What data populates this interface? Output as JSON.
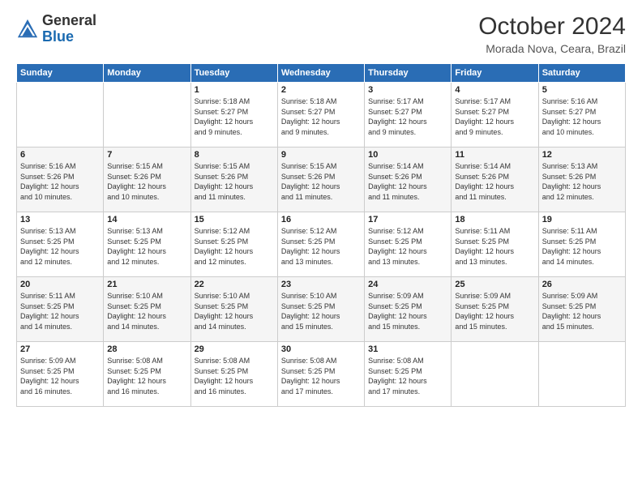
{
  "logo": {
    "general": "General",
    "blue": "Blue"
  },
  "header": {
    "month": "October 2024",
    "location": "Morada Nova, Ceara, Brazil"
  },
  "weekdays": [
    "Sunday",
    "Monday",
    "Tuesday",
    "Wednesday",
    "Thursday",
    "Friday",
    "Saturday"
  ],
  "weeks": [
    [
      {
        "day": "",
        "details": ""
      },
      {
        "day": "",
        "details": ""
      },
      {
        "day": "1",
        "details": "Sunrise: 5:18 AM\nSunset: 5:27 PM\nDaylight: 12 hours\nand 9 minutes."
      },
      {
        "day": "2",
        "details": "Sunrise: 5:18 AM\nSunset: 5:27 PM\nDaylight: 12 hours\nand 9 minutes."
      },
      {
        "day": "3",
        "details": "Sunrise: 5:17 AM\nSunset: 5:27 PM\nDaylight: 12 hours\nand 9 minutes."
      },
      {
        "day": "4",
        "details": "Sunrise: 5:17 AM\nSunset: 5:27 PM\nDaylight: 12 hours\nand 9 minutes."
      },
      {
        "day": "5",
        "details": "Sunrise: 5:16 AM\nSunset: 5:27 PM\nDaylight: 12 hours\nand 10 minutes."
      }
    ],
    [
      {
        "day": "6",
        "details": "Sunrise: 5:16 AM\nSunset: 5:26 PM\nDaylight: 12 hours\nand 10 minutes."
      },
      {
        "day": "7",
        "details": "Sunrise: 5:15 AM\nSunset: 5:26 PM\nDaylight: 12 hours\nand 10 minutes."
      },
      {
        "day": "8",
        "details": "Sunrise: 5:15 AM\nSunset: 5:26 PM\nDaylight: 12 hours\nand 11 minutes."
      },
      {
        "day": "9",
        "details": "Sunrise: 5:15 AM\nSunset: 5:26 PM\nDaylight: 12 hours\nand 11 minutes."
      },
      {
        "day": "10",
        "details": "Sunrise: 5:14 AM\nSunset: 5:26 PM\nDaylight: 12 hours\nand 11 minutes."
      },
      {
        "day": "11",
        "details": "Sunrise: 5:14 AM\nSunset: 5:26 PM\nDaylight: 12 hours\nand 11 minutes."
      },
      {
        "day": "12",
        "details": "Sunrise: 5:13 AM\nSunset: 5:26 PM\nDaylight: 12 hours\nand 12 minutes."
      }
    ],
    [
      {
        "day": "13",
        "details": "Sunrise: 5:13 AM\nSunset: 5:25 PM\nDaylight: 12 hours\nand 12 minutes."
      },
      {
        "day": "14",
        "details": "Sunrise: 5:13 AM\nSunset: 5:25 PM\nDaylight: 12 hours\nand 12 minutes."
      },
      {
        "day": "15",
        "details": "Sunrise: 5:12 AM\nSunset: 5:25 PM\nDaylight: 12 hours\nand 12 minutes."
      },
      {
        "day": "16",
        "details": "Sunrise: 5:12 AM\nSunset: 5:25 PM\nDaylight: 12 hours\nand 13 minutes."
      },
      {
        "day": "17",
        "details": "Sunrise: 5:12 AM\nSunset: 5:25 PM\nDaylight: 12 hours\nand 13 minutes."
      },
      {
        "day": "18",
        "details": "Sunrise: 5:11 AM\nSunset: 5:25 PM\nDaylight: 12 hours\nand 13 minutes."
      },
      {
        "day": "19",
        "details": "Sunrise: 5:11 AM\nSunset: 5:25 PM\nDaylight: 12 hours\nand 14 minutes."
      }
    ],
    [
      {
        "day": "20",
        "details": "Sunrise: 5:11 AM\nSunset: 5:25 PM\nDaylight: 12 hours\nand 14 minutes."
      },
      {
        "day": "21",
        "details": "Sunrise: 5:10 AM\nSunset: 5:25 PM\nDaylight: 12 hours\nand 14 minutes."
      },
      {
        "day": "22",
        "details": "Sunrise: 5:10 AM\nSunset: 5:25 PM\nDaylight: 12 hours\nand 14 minutes."
      },
      {
        "day": "23",
        "details": "Sunrise: 5:10 AM\nSunset: 5:25 PM\nDaylight: 12 hours\nand 15 minutes."
      },
      {
        "day": "24",
        "details": "Sunrise: 5:09 AM\nSunset: 5:25 PM\nDaylight: 12 hours\nand 15 minutes."
      },
      {
        "day": "25",
        "details": "Sunrise: 5:09 AM\nSunset: 5:25 PM\nDaylight: 12 hours\nand 15 minutes."
      },
      {
        "day": "26",
        "details": "Sunrise: 5:09 AM\nSunset: 5:25 PM\nDaylight: 12 hours\nand 15 minutes."
      }
    ],
    [
      {
        "day": "27",
        "details": "Sunrise: 5:09 AM\nSunset: 5:25 PM\nDaylight: 12 hours\nand 16 minutes."
      },
      {
        "day": "28",
        "details": "Sunrise: 5:08 AM\nSunset: 5:25 PM\nDaylight: 12 hours\nand 16 minutes."
      },
      {
        "day": "29",
        "details": "Sunrise: 5:08 AM\nSunset: 5:25 PM\nDaylight: 12 hours\nand 16 minutes."
      },
      {
        "day": "30",
        "details": "Sunrise: 5:08 AM\nSunset: 5:25 PM\nDaylight: 12 hours\nand 17 minutes."
      },
      {
        "day": "31",
        "details": "Sunrise: 5:08 AM\nSunset: 5:25 PM\nDaylight: 12 hours\nand 17 minutes."
      },
      {
        "day": "",
        "details": ""
      },
      {
        "day": "",
        "details": ""
      }
    ]
  ]
}
